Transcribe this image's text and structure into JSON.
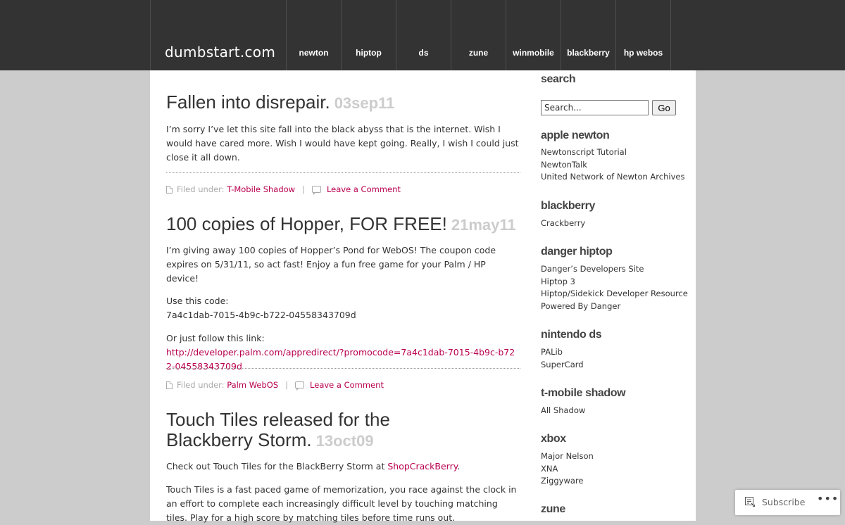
{
  "site": {
    "title": "dumbstart.com"
  },
  "nav": [
    "newton",
    "hiptop",
    "ds",
    "zune",
    "winmobile",
    "blackberry",
    "hp webos"
  ],
  "posts": [
    {
      "title": "Fallen into disrepair.",
      "date": "03sep11",
      "body": "I’m sorry I’ve let this site fall into the black abyss that is the internet. Wish I would have cared more. Wish I would have kept going. Really, I wish I could just close it all down.",
      "filed_label": "Filed under:",
      "category": "T-Mobile Shadow",
      "separator": "|",
      "comment_label": "Leave a Comment"
    },
    {
      "title": "100 copies of Hopper, FOR FREE!",
      "date": "21may11",
      "body1": "I’m giving away 100 copies of Hopper’s Pond for WebOS! The coupon code expires on 5/31/11, so act fast! Enjoy a fun free game for your Palm / HP device!",
      "code_label": "Use this code:",
      "code": "7a4c1dab-7015-4b9c-b722-04558343709d",
      "link_label": "Or just follow this link:",
      "link": "http://developer.palm.com/appredirect/?promocode=7a4c1dab-7015-4b9c-b722-04558343709d",
      "filed_label": "Filed under:",
      "category": "Palm WebOS",
      "separator": "|",
      "comment_label": "Leave a Comment"
    },
    {
      "title_line1": "Touch Tiles released for the",
      "title_line2": "Blackberry Storm.",
      "date": "13oct09",
      "body1_prefix": "Check out Touch Tiles for the BlackBerry Storm at ",
      "body1_link": "ShopCrackBerry",
      "body1_suffix": ".",
      "body2": "Touch Tiles is a fast paced game of memorization, you race against the clock in an effort to complete each increasingly difficult level by touching matching tiles. Play for a high score by matching tiles before time runs out."
    }
  ],
  "sidebar": {
    "search": {
      "title": "search",
      "placeholder": "Search...",
      "button": "Go"
    },
    "widgets": [
      {
        "title": "apple newton",
        "items": [
          "Newtonscript Tutorial",
          "NewtonTalk",
          "United Network of Newton Archives"
        ]
      },
      {
        "title": "blackberry",
        "items": [
          "Crackberry"
        ]
      },
      {
        "title": "danger hiptop",
        "items": [
          "Danger’s Developers Site",
          "Hiptop 3",
          "Hiptop/Sidekick Developer Resource",
          "Powered By Danger"
        ]
      },
      {
        "title": "nintendo ds",
        "items": [
          "PALib",
          "SuperCard"
        ]
      },
      {
        "title": "t-mobile shadow",
        "items": [
          "All Shadow"
        ]
      },
      {
        "title": "xbox",
        "items": [
          "Major Nelson",
          "XNA",
          "Ziggyware"
        ]
      },
      {
        "title": "zune",
        "items": []
      }
    ]
  },
  "subscribe": {
    "label": "Subscribe",
    "more": "•••"
  },
  "colors": {
    "header_bg": "#333333",
    "link": "#b8004f",
    "date": "#cccccc",
    "page_bg": "#cccccc"
  }
}
